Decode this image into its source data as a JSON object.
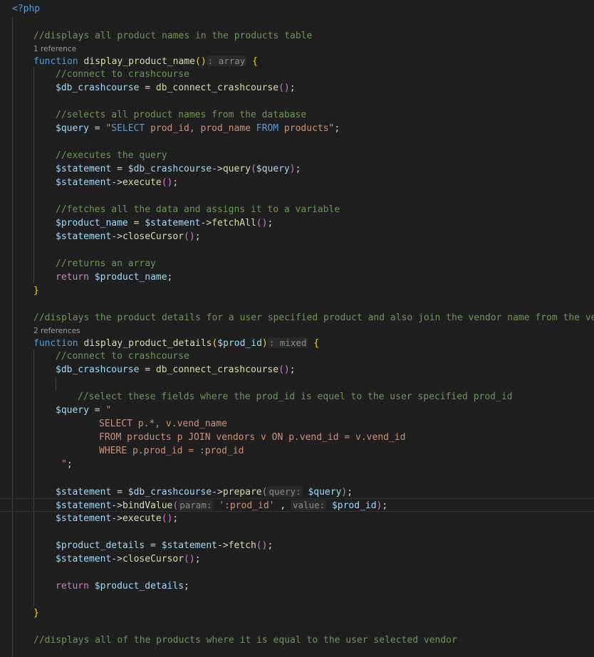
{
  "editor": {
    "language": "php",
    "colors": {
      "background": "#1f1f1f",
      "comment": "#6a9955",
      "keyword": "#569cd6",
      "function": "#dcdcaa",
      "variable": "#9cdcfe",
      "string": "#ce9178"
    }
  },
  "code": {
    "php_open": "<?php",
    "c1": "//displays all product names in the products table",
    "lens1": "1 reference",
    "f1_kw": "function",
    "f1_name": "display_product_name",
    "f1_paren": "()",
    "f1_hint": ": array",
    "brace_open": "{",
    "brace_close": "}",
    "c2": "//connect to crashcourse",
    "v_db": "$db_crashcourse",
    "eq": " = ",
    "fn_connect": "db_connect_crashcourse",
    "paren_empty": "()",
    "semi": ";",
    "c3": "//selects all product names from the database",
    "v_query": "$query",
    "sql_q": "\"",
    "sql_select": "SELECT",
    "sql_mid": " prod_id, prod_name ",
    "sql_from": "FROM",
    "sql_tail": " products\"",
    "c4": "//executes the query",
    "v_statement": "$statement",
    "arrow": "->",
    "m_query": "query",
    "paren_open": "(",
    "paren_close": ")",
    "m_execute": "execute",
    "c5": "//fetches all the data and assigns it to a variable",
    "v_product_name": "$product_name",
    "m_fetchall": "fetchAll",
    "m_closecursor": "closeCursor",
    "c6": "//returns an array",
    "kw_return": "return",
    "c7": "//displays the product details for a user specified product and also join the vendor name from the vend",
    "lens2": "2 references",
    "f2_name": "display_product_details",
    "v_prod_id": "$prod_id",
    "f2_hint": ": mixed",
    "c8": "//select these fields where the prod_id is equel to the user specified prod_id",
    "sql2_open": "\"",
    "sql2_l1": "SELECT p.*, v.vend_name",
    "sql2_l2": "FROM products p JOIN vendors v ON p.vend_id = v.vend_id",
    "sql2_l3": "WHERE p.prod_id = :prod_id",
    "sql2_close": "\"",
    "m_prepare": "prepare",
    "hint_query": "query:",
    "m_bindvalue": "bindValue",
    "hint_param": "param:",
    "str_prod_id": "':prod_id'",
    "comma": " ,",
    "hint_value": "value:",
    "v_product_details": "$product_details",
    "m_fetch": "fetch",
    "c9": "//displays all of the products where it is equal to the user selected vendor"
  }
}
